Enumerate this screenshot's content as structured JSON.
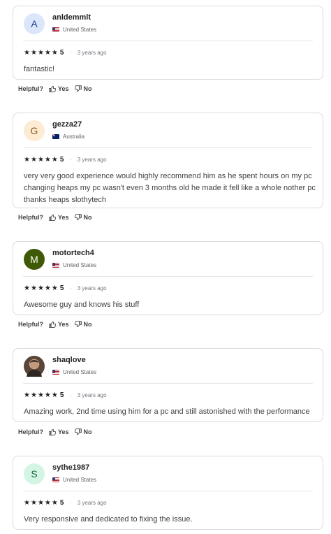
{
  "reviews": [
    {
      "avatar_letter": "A",
      "avatar_bg": "#dbe6fb",
      "avatar_color": "#1a3c8c",
      "username": "anldemmlt",
      "country": "United States",
      "flag": "us",
      "rating": "5",
      "date": "3 years ago",
      "text": "fantastic!"
    },
    {
      "avatar_letter": "G",
      "avatar_bg": "#fdebd3",
      "avatar_color": "#8a5a14",
      "username": "gezza27",
      "country": "Australia",
      "flag": "au",
      "rating": "5",
      "date": "3 years ago",
      "text": "very very good experience would highly recommend him as he spent hours on my pc changing heaps my pc wasn't even 3 months old he made it fell like a whole nother pc thanks heaps slothytech"
    },
    {
      "avatar_letter": "M",
      "avatar_bg": "#3f5a06",
      "avatar_color": "#ffffff",
      "username": "motortech4",
      "country": "United States",
      "flag": "us",
      "rating": "5",
      "date": "3 years ago",
      "text": "Awesome guy and knows his stuff"
    },
    {
      "avatar_letter": "",
      "avatar_bg": "#5a4638",
      "avatar_color": "#ffffff",
      "username": "shaqlove",
      "country": "United States",
      "flag": "us",
      "rating": "5",
      "date": "3 years ago",
      "text": "Amazing work, 2nd time using him for a pc and still astonished with the performance"
    },
    {
      "avatar_letter": "S",
      "avatar_bg": "#d4f5e4",
      "avatar_color": "#0e6b3a",
      "username": "sythe1987",
      "country": "United States",
      "flag": "us",
      "rating": "5",
      "date": "3 years ago",
      "text": "Very responsive and dedicated to fixing the issue."
    }
  ],
  "helpful": {
    "label": "Helpful?",
    "yes": "Yes",
    "no": "No"
  },
  "icons": {
    "star": "star-icon",
    "thumbs_up": "thumbs-up-icon",
    "thumbs_down": "thumbs-down-icon"
  }
}
